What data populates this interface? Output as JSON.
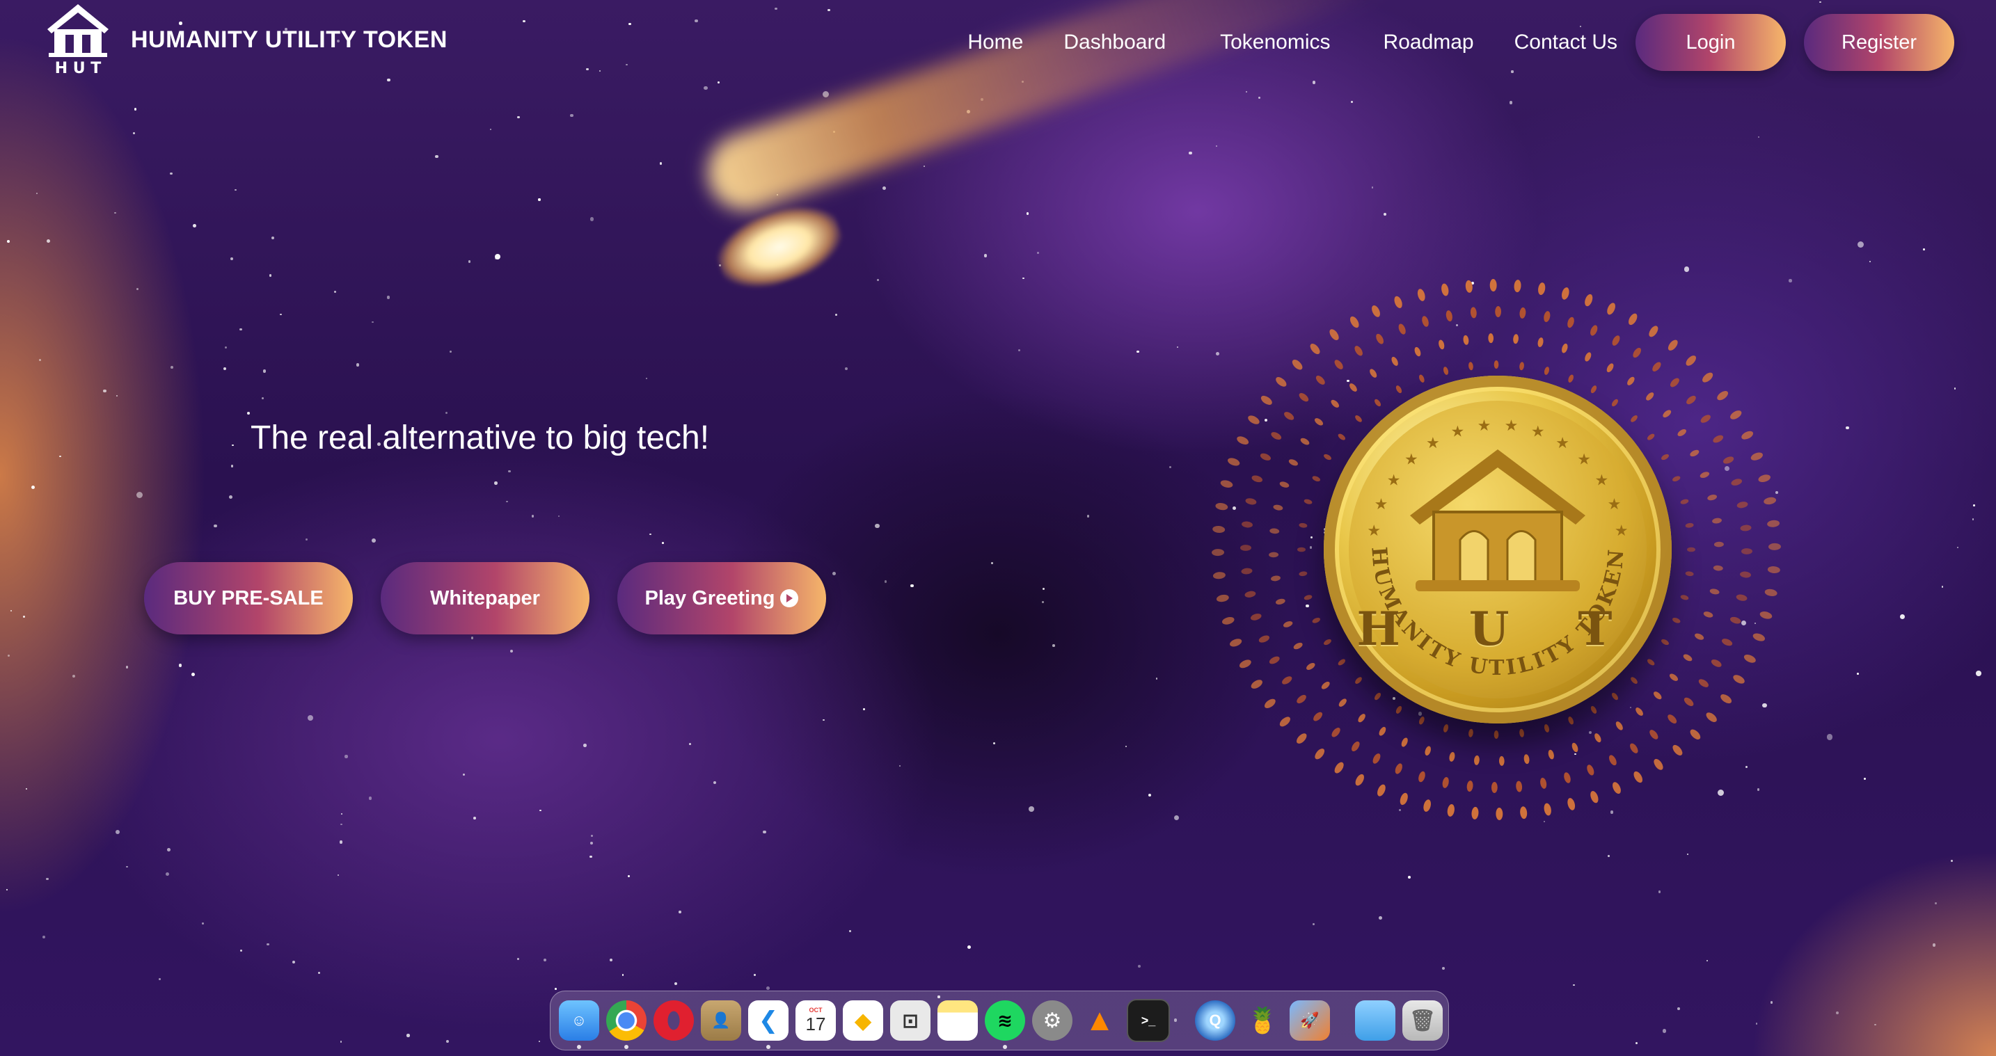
{
  "header": {
    "brand_title": "HUMANITY UTILITY TOKEN",
    "logo_text": "H U T",
    "nav": [
      "Home",
      "Dashboard",
      "Tokenomics",
      "Roadmap",
      "Contact Us"
    ],
    "login_label": "Login",
    "register_label": "Register"
  },
  "hero": {
    "tagline": "The real alternative to big tech!",
    "buttons": {
      "buy": "BUY PRE-SALE",
      "whitepaper": "Whitepaper",
      "play": "Play Greeting"
    }
  },
  "coin": {
    "letters": "H U T",
    "ring_text": "HUMANITY UTILITY TOKEN"
  },
  "dock": {
    "calendar_month": "OCT",
    "calendar_day": "17",
    "apps": [
      "finder",
      "chrome",
      "opera",
      "contacts",
      "vscode",
      "calendar",
      "sketch",
      "screenshot",
      "notes",
      "spotify",
      "system-preferences",
      "vlc",
      "terminal",
      "quicktime",
      "cocktail",
      "rocket-typist",
      "folder",
      "trash"
    ]
  },
  "colors": {
    "button_gradient_start": "#5a2a7e",
    "button_gradient_mid": "#b2456a",
    "button_gradient_end": "#f6b66a",
    "coin_gold": "#d7ac30"
  }
}
